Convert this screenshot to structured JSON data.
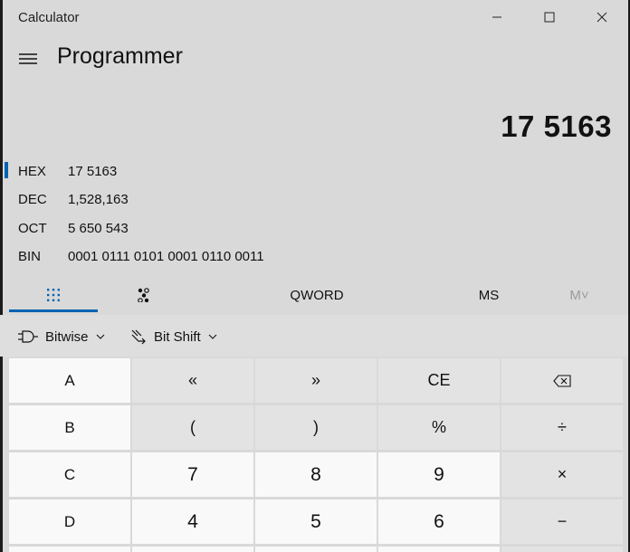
{
  "window": {
    "title": "Calculator",
    "minimize_icon": "minimize-icon",
    "maximize_icon": "maximize-icon",
    "close_icon": "close-icon"
  },
  "header": {
    "menu_icon": "hamburger-menu-icon",
    "mode": "Programmer"
  },
  "display": {
    "value": "17 5163"
  },
  "radix": [
    {
      "label": "HEX",
      "value": "17 5163",
      "selected": true
    },
    {
      "label": "DEC",
      "value": "1,528,163",
      "selected": false
    },
    {
      "label": "OCT",
      "value": "5 650 543",
      "selected": false
    },
    {
      "label": "BIN",
      "value": "0001 0111 0101 0001 0110 0011",
      "selected": false
    }
  ],
  "tabs": {
    "full_keypad_icon": "full-keypad-icon",
    "bit_toggle_icon": "bit-toggle-keypad-icon",
    "word_size": "QWORD",
    "memory_store": "MS",
    "memory_list": "M˅"
  },
  "toolbar": {
    "bitwise": "Bitwise",
    "bit_shift": "Bit Shift"
  },
  "keys": {
    "row1": [
      "A",
      "«",
      "»",
      "CE",
      "⌫"
    ],
    "row2": [
      "B",
      "(",
      ")",
      "%",
      "÷"
    ],
    "row3": [
      "C",
      "7",
      "8",
      "9",
      "×"
    ],
    "row4": [
      "D",
      "4",
      "5",
      "6",
      "−"
    ]
  },
  "colors": {
    "accent": "#0063b1",
    "background": "#d9d9d9"
  }
}
